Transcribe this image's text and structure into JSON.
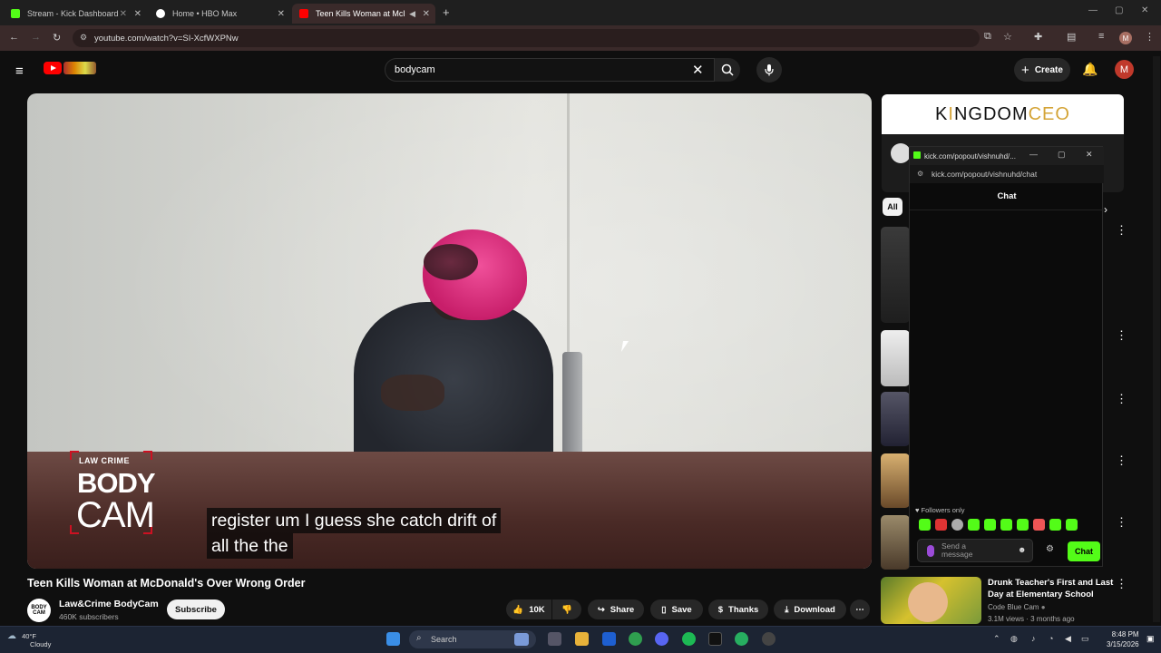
{
  "browser": {
    "tabs": [
      {
        "title": "Stream - Kick Dashboard",
        "favicon_color": "#53fc18"
      },
      {
        "title": "Home • HBO Max",
        "favicon_color": "#ffffff"
      },
      {
        "title": "Teen Kills Woman at McDon",
        "favicon_color": "#ff0000"
      }
    ],
    "new_tab_icon": "plus-icon",
    "url": "youtube.com/watch?v=SI-XcfWXPNw",
    "profile_initial": "M"
  },
  "youtube": {
    "search_value": "bodycam",
    "create_label": "Create",
    "avatar_initial": "M"
  },
  "video": {
    "caption_line1": "register um I guess she catch drift of",
    "caption_line2": "all the the",
    "badge_small": "LAW  CRIME",
    "badge_body": "BODY",
    "badge_cam": "CAM",
    "title": "Teen Kills Woman at McDonald's Over Wrong Order",
    "channel_name": "Law&Crime BodyCam",
    "channel_avatar_text": "BODY CAM",
    "subscribers": "460K subscribers",
    "subscribe_label": "Subscribe",
    "like_count": "10K",
    "share_label": "Share",
    "save_label": "Save",
    "thanks_label": "Thanks",
    "download_label": "Download"
  },
  "sidebar": {
    "ad_brand_part1": "K",
    "ad_brand_i": "I",
    "ad_brand_part2": "NGDOM ",
    "ad_brand_part3": "CEO",
    "chip_all": "All",
    "rec_title": "Drunk Teacher's First and Last Day at Elementary School",
    "rec_channel": "Code Blue Cam",
    "rec_meta": "3.1M views · 3 months ago"
  },
  "popout": {
    "window_title": "kick.com/popout/vishnuhd/...",
    "url": "kick.com/popout/vishnuhd/chat",
    "heading": "Chat",
    "followers_only": "Followers only",
    "message_placeholder": "Send a message",
    "chat_button": "Chat"
  },
  "taskbar": {
    "temperature": "40°F",
    "weather": "Cloudy",
    "search_label": "Search",
    "time": "8:48 PM",
    "date": "3/15/2026"
  },
  "colors": {
    "kick_green": "#53fc18",
    "yt_red": "#ff0000",
    "avatar_red": "#c0392b"
  }
}
